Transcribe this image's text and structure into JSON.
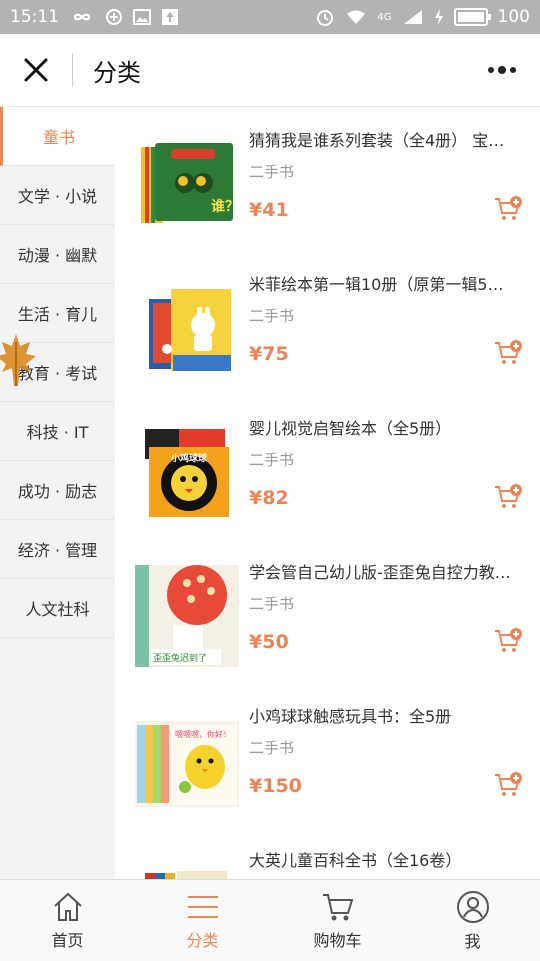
{
  "status_bar": {
    "time": "15:11",
    "network": "4G",
    "battery": "100"
  },
  "header": {
    "title": "分类"
  },
  "sidebar": {
    "items": [
      {
        "label": "童书",
        "active": true
      },
      {
        "label": "文学 · 小说",
        "active": false
      },
      {
        "label": "动漫 · 幽默",
        "active": false
      },
      {
        "label": "生活 · 育儿",
        "active": false
      },
      {
        "label": "教育 · 考试",
        "active": false
      },
      {
        "label": "科技 · IT",
        "active": false
      },
      {
        "label": "成功 · 励志",
        "active": false
      },
      {
        "label": "经济 · 管理",
        "active": false
      },
      {
        "label": "人文社科",
        "active": false
      }
    ]
  },
  "products": [
    {
      "title": "猜猜我是谁系列套装（全4册） 宝…",
      "condition": "二手书",
      "price": "¥41"
    },
    {
      "title": "米菲绘本第一辑10册（原第一辑5…",
      "condition": "二手书",
      "price": "¥75"
    },
    {
      "title": "婴儿视觉启智绘本（全5册）",
      "condition": "二手书",
      "price": "¥82"
    },
    {
      "title": "学会管自己幼儿版-歪歪兔自控力教…",
      "condition": "二手书",
      "price": "¥50"
    },
    {
      "title": "小鸡球球触感玩具书：全5册",
      "condition": "二手书",
      "price": "¥150"
    },
    {
      "title": "大英儿童百科全书（全16卷）",
      "condition": "",
      "price": ""
    }
  ],
  "cover_text": {
    "book1": "谁？",
    "book3": "小鸡球球",
    "book4": "歪歪兔迟到了",
    "book5": "喂喂喂，你好！"
  },
  "tabbar": {
    "items": [
      {
        "label": "首页",
        "icon": "home-icon",
        "active": false
      },
      {
        "label": "分类",
        "icon": "menu-icon",
        "active": true
      },
      {
        "label": "购物车",
        "icon": "cart-icon",
        "active": false
      },
      {
        "label": "我",
        "icon": "user-icon",
        "active": false
      }
    ]
  },
  "colors": {
    "accent": "#e8865a",
    "status_bar": "#b3b3b3",
    "sidebar_bg": "#f3f3f3"
  }
}
